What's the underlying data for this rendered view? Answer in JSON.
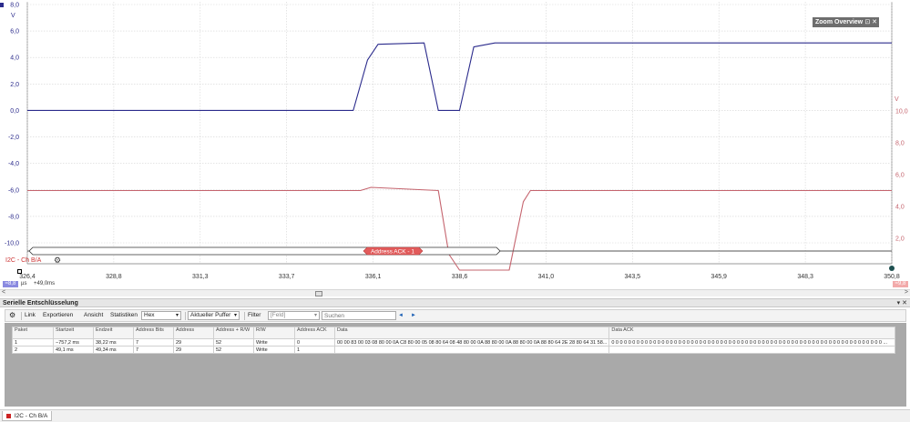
{
  "scope": {
    "left_axis": {
      "unit": "V",
      "ticks": [
        "8,0",
        "6,0",
        "4,0",
        "2,0",
        "0,0",
        "-2,0",
        "-4,0",
        "-6,0",
        "-8,0",
        "-10,0"
      ]
    },
    "right_axis": {
      "unit": "V",
      "ticks": [
        "10,0",
        "8,0",
        "6,0",
        "4,0",
        "2,0"
      ]
    },
    "x_ticks": [
      "326,4",
      "328,8",
      "331,3",
      "333,7",
      "336,1",
      "338,6",
      "341,0",
      "343,5",
      "345,9",
      "348,3",
      "350,8"
    ],
    "x_unit": "µs",
    "zoom_overview": {
      "label": "Zoom Overview",
      "icons": "⊡ ✕"
    },
    "decode_channel_label": "I2C - Ch B/A",
    "decode_packet_label": "Address ACK - 1",
    "ruler_left_badge": "≈8,8",
    "ruler_right_badge": "≈9,8",
    "ruler_unit": "µs",
    "ruler_time": "+49,0ms",
    "colors": {
      "channel_a": "#2b2b8c",
      "channel_b": "#c5646e",
      "packet": "#e25b5b"
    }
  },
  "chart_data": {
    "type": "line",
    "x_range": [
      326.4,
      350.8
    ],
    "series": [
      {
        "color": "#2b2b8c",
        "axis": "left",
        "points": [
          [
            326.4,
            0.0
          ],
          [
            335.6,
            0.0
          ],
          [
            336.0,
            3.8
          ],
          [
            336.3,
            5.0
          ],
          [
            337.6,
            5.1
          ],
          [
            338.0,
            0.0
          ],
          [
            338.6,
            0.0
          ],
          [
            339.0,
            4.8
          ],
          [
            339.6,
            5.1
          ],
          [
            350.8,
            5.1
          ]
        ]
      },
      {
        "color": "#c5646e",
        "axis": "right",
        "points": [
          [
            326.4,
            5.0
          ],
          [
            335.8,
            5.0
          ],
          [
            336.1,
            5.2
          ],
          [
            338.0,
            5.0
          ],
          [
            338.3,
            1.0
          ],
          [
            338.6,
            0.0
          ],
          [
            340.0,
            0.0
          ],
          [
            340.4,
            4.3
          ],
          [
            340.6,
            5.0
          ],
          [
            350.8,
            5.0
          ]
        ]
      }
    ],
    "left_ylim": [
      -10.0,
      8.0
    ],
    "right_ylim": [
      0.0,
      10.0
    ]
  },
  "panel": {
    "title": "Serielle Entschlüsselung",
    "icons": "▾ ✕"
  },
  "toolbar": {
    "gear": "⚙",
    "link": "Link",
    "export": "Exportieren",
    "view": "Ansicht",
    "statistics": "Statistiken",
    "format": "Hex",
    "buffer": "Aktueller Puffer",
    "filter": "Filter",
    "field": "[Feld]",
    "search_placeholder": "Suchen",
    "prev": "◄",
    "next": "►"
  },
  "table": {
    "columns": [
      "Paket",
      "Startzeit",
      "Endzeit",
      "Address Bits",
      "Address",
      "Address + R/W",
      "R/W",
      "Address ACK",
      "Data",
      "Data ACK"
    ],
    "rows": [
      [
        "1",
        "−757,2 ms",
        "38,22 ms",
        "7",
        "29",
        "52",
        "Write",
        "0",
        "00 00 83 00 03 08 80 00 0A C8 80 00 05 08 80 64 08 48 80 00 0A 88 80 00 0A 88 80 00 0A 88 80 64 2E 28 80 64 31 58...",
        "0 0 0 0 0 0 0 0 0 0 0 0 0 0 0 0 0 0 0 0 0 0 0 0 0 0 0 0 0 0 0 0 0 0 0 0 0 0 0 0 0 0 0 0 0 0 0 0 0 0 0 0 0 0 0 0 0 0 0 0 0 0 0 0 0 ..."
      ],
      [
        "2",
        "49,1 ms",
        "49,34 ms",
        "7",
        "29",
        "52",
        "Write",
        "1",
        "",
        ""
      ]
    ]
  },
  "bottom_tab": {
    "label": "I2C - Ch B/A"
  }
}
